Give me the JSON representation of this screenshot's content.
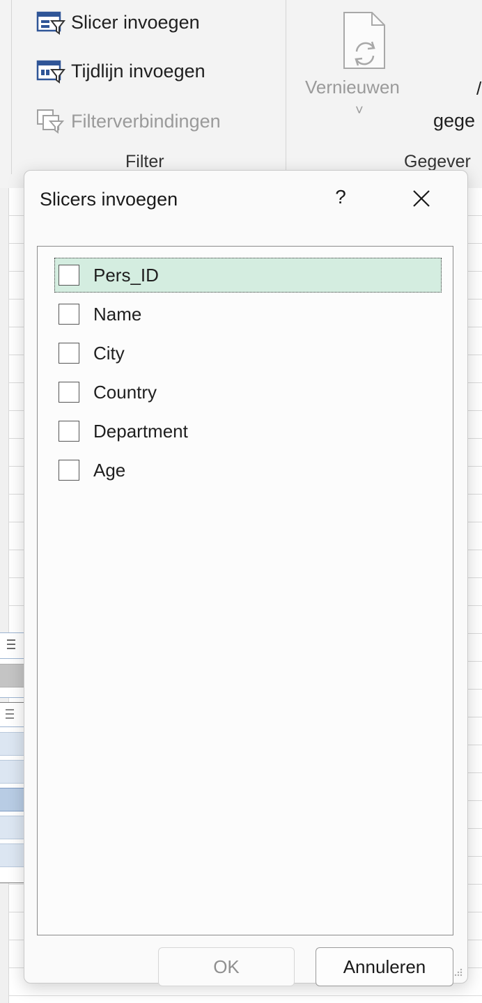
{
  "ribbon": {
    "filter_group": {
      "items": [
        {
          "label": "Slicer invoegen",
          "icon": "slicer-icon",
          "enabled": true
        },
        {
          "label": "Tijdlijn invoegen",
          "icon": "timeline-icon",
          "enabled": true
        },
        {
          "label": "Filterverbindingen",
          "icon": "filter-connections-icon",
          "enabled": false
        }
      ],
      "label": "Filter"
    },
    "data_group": {
      "refresh_label": "Vernieuwen",
      "refresh_chevron": "˅",
      "partial_label": "gege",
      "partial_slash": "/",
      "label": "Gegever"
    }
  },
  "dialog": {
    "title": "Slicers invoegen",
    "help": "?",
    "fields": [
      {
        "label": "Pers_ID",
        "checked": false,
        "focused": true
      },
      {
        "label": "Name",
        "checked": false
      },
      {
        "label": "City",
        "checked": false
      },
      {
        "label": "Country",
        "checked": false
      },
      {
        "label": "Department",
        "checked": false
      },
      {
        "label": "Age",
        "checked": false
      }
    ],
    "ok_label": "OK",
    "cancel_label": "Annuleren"
  },
  "colors": {
    "selected_row": "#d4ede0",
    "slicer_border": "#9bb3d1",
    "slicer_button": "#dce6f2",
    "slicer_button_selected": "#b8cce4",
    "clear_filter_red": "#d9262c"
  }
}
